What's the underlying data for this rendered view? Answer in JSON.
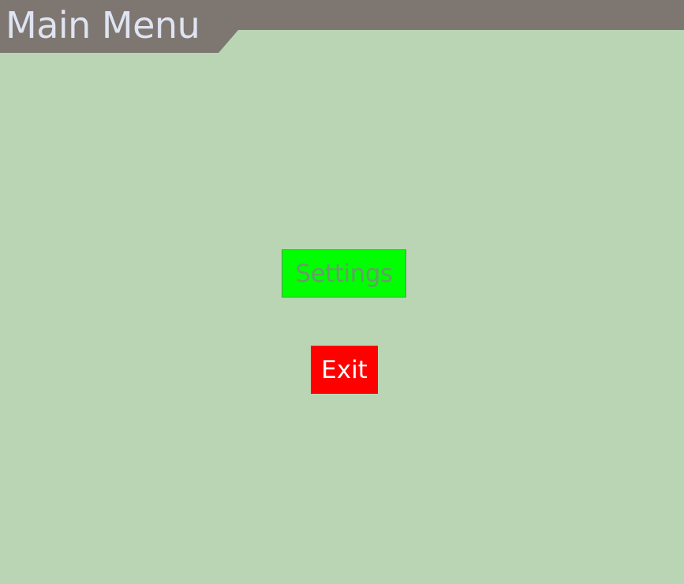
{
  "header": {
    "title": "Main Menu"
  },
  "menu": {
    "settings_label": "Settings",
    "exit_label": "Exit"
  },
  "colors": {
    "background": "#bad5b4",
    "header_bar": "#7e7771",
    "title_text": "#dfe4f3",
    "settings_bg": "#00ff00",
    "settings_text": "#6a9a6a",
    "exit_bg": "#ff0000",
    "exit_text": "#ffffff"
  }
}
